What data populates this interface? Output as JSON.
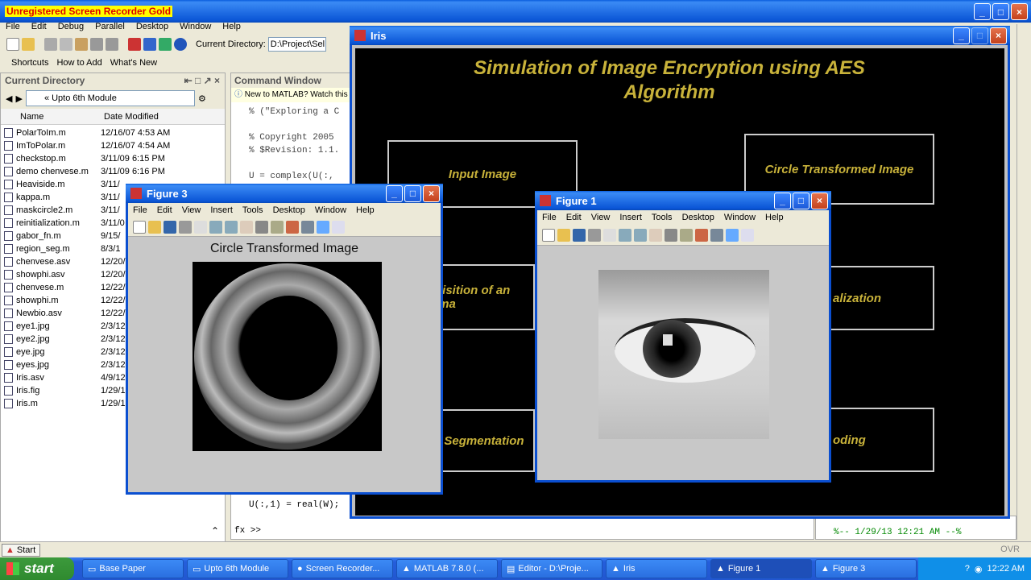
{
  "recorder_banner": "Unregistered Screen Recorder Gold",
  "matlab": {
    "menu": [
      "File",
      "Edit",
      "Debug",
      "Parallel",
      "Desktop",
      "Window",
      "Help"
    ],
    "current_dir_label": "Current Directory:",
    "current_dir_value": "D:\\Project\\Sel",
    "shortcuts": [
      "Shortcuts",
      "How to Add",
      "What's New"
    ],
    "current_directory_panel": {
      "title": "Current Directory",
      "path": "« Upto 6th Module",
      "col_name": "Name",
      "col_date": "Date Modified",
      "files": [
        {
          "name": "PolarToIm.m",
          "date": "12/16/07 4:53 AM"
        },
        {
          "name": "ImToPolar.m",
          "date": "12/16/07 4:54 AM"
        },
        {
          "name": "checkstop.m",
          "date": "3/11/09 6:15 PM"
        },
        {
          "name": "demo chenvese.m",
          "date": "3/11/09 6:16 PM"
        },
        {
          "name": "Heaviside.m",
          "date": "3/11/"
        },
        {
          "name": "kappa.m",
          "date": "3/11/"
        },
        {
          "name": "maskcircle2.m",
          "date": "3/11/"
        },
        {
          "name": "reinitialization.m",
          "date": "3/11/0"
        },
        {
          "name": "gabor_fn.m",
          "date": "9/15/"
        },
        {
          "name": "region_seg.m",
          "date": "8/3/1"
        },
        {
          "name": "chenvese.asv",
          "date": "12/20/"
        },
        {
          "name": "showphi.asv",
          "date": "12/20/"
        },
        {
          "name": "chenvese.m",
          "date": "12/22/"
        },
        {
          "name": "showphi.m",
          "date": "12/22/"
        },
        {
          "name": "Newbio.asv",
          "date": "12/22/"
        },
        {
          "name": "eye1.jpg",
          "date": "2/3/12"
        },
        {
          "name": "eye2.jpg",
          "date": "2/3/12"
        },
        {
          "name": "eye.jpg",
          "date": "2/3/12"
        },
        {
          "name": "eyes.jpg",
          "date": "2/3/12"
        },
        {
          "name": "Iris.asv",
          "date": "4/9/12"
        },
        {
          "name": "Iris.fig",
          "date": "1/29/1"
        },
        {
          "name": "Iris.m",
          "date": "1/29/1"
        }
      ]
    },
    "command_window": {
      "title": "Command Window",
      "tip": "New to MATLAB? Watch this",
      "lines": [
        "% (\"Exploring a C",
        "",
        "% Copyright 2005",
        "% $Revision: 1.1.",
        "",
        "U = complex(U(:,"
      ],
      "bottom_line": "U(:,1) = real(W);",
      "prompt": "fx >>"
    },
    "history_line": "%-- 1/29/13 12:21 AM --%",
    "ovr": "OVR",
    "start_small": "Start"
  },
  "iris_window": {
    "title": "Iris",
    "heading_line1": "Simulation of Image Encryption using AES",
    "heading_line2": "Algorithm",
    "boxes": {
      "input_image": "Input Image",
      "circle_transformed": "Circle Transformed Image",
      "acquisition": "uisition of an ima",
      "normalization": "alization",
      "segmentation": "Segmentation",
      "encoding": "oding"
    }
  },
  "figure3": {
    "title": "Figure 3",
    "menu": [
      "File",
      "Edit",
      "View",
      "Insert",
      "Tools",
      "Desktop",
      "Window",
      "Help"
    ],
    "plot_title": "Circle Transformed Image"
  },
  "figure1": {
    "title": "Figure 1",
    "menu": [
      "File",
      "Edit",
      "View",
      "Insert",
      "Tools",
      "Desktop",
      "Window",
      "Help"
    ]
  },
  "taskbar": {
    "start": "start",
    "items": [
      "Base Paper",
      "Upto 6th Module",
      "Screen Recorder...",
      "MATLAB 7.8.0 (...",
      "Editor - D:\\Proje...",
      "Iris",
      "Figure 1",
      "Figure 3"
    ],
    "time": "12:22 AM"
  }
}
